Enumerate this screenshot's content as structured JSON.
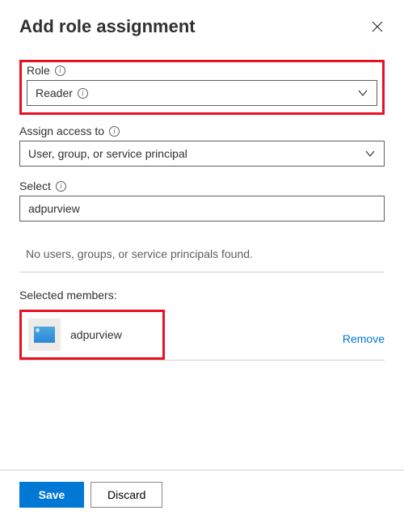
{
  "header": {
    "title": "Add role assignment"
  },
  "fields": {
    "role": {
      "label": "Role",
      "value": "Reader"
    },
    "assign_access_to": {
      "label": "Assign access to",
      "value": "User, group, or service principal"
    },
    "select": {
      "label": "Select",
      "value": "adpurview"
    }
  },
  "results": {
    "empty_message": "No users, groups, or service principals found."
  },
  "selected": {
    "label": "Selected members:",
    "members": [
      {
        "name": "adpurview"
      }
    ],
    "remove_label": "Remove"
  },
  "footer": {
    "save_label": "Save",
    "discard_label": "Discard"
  }
}
